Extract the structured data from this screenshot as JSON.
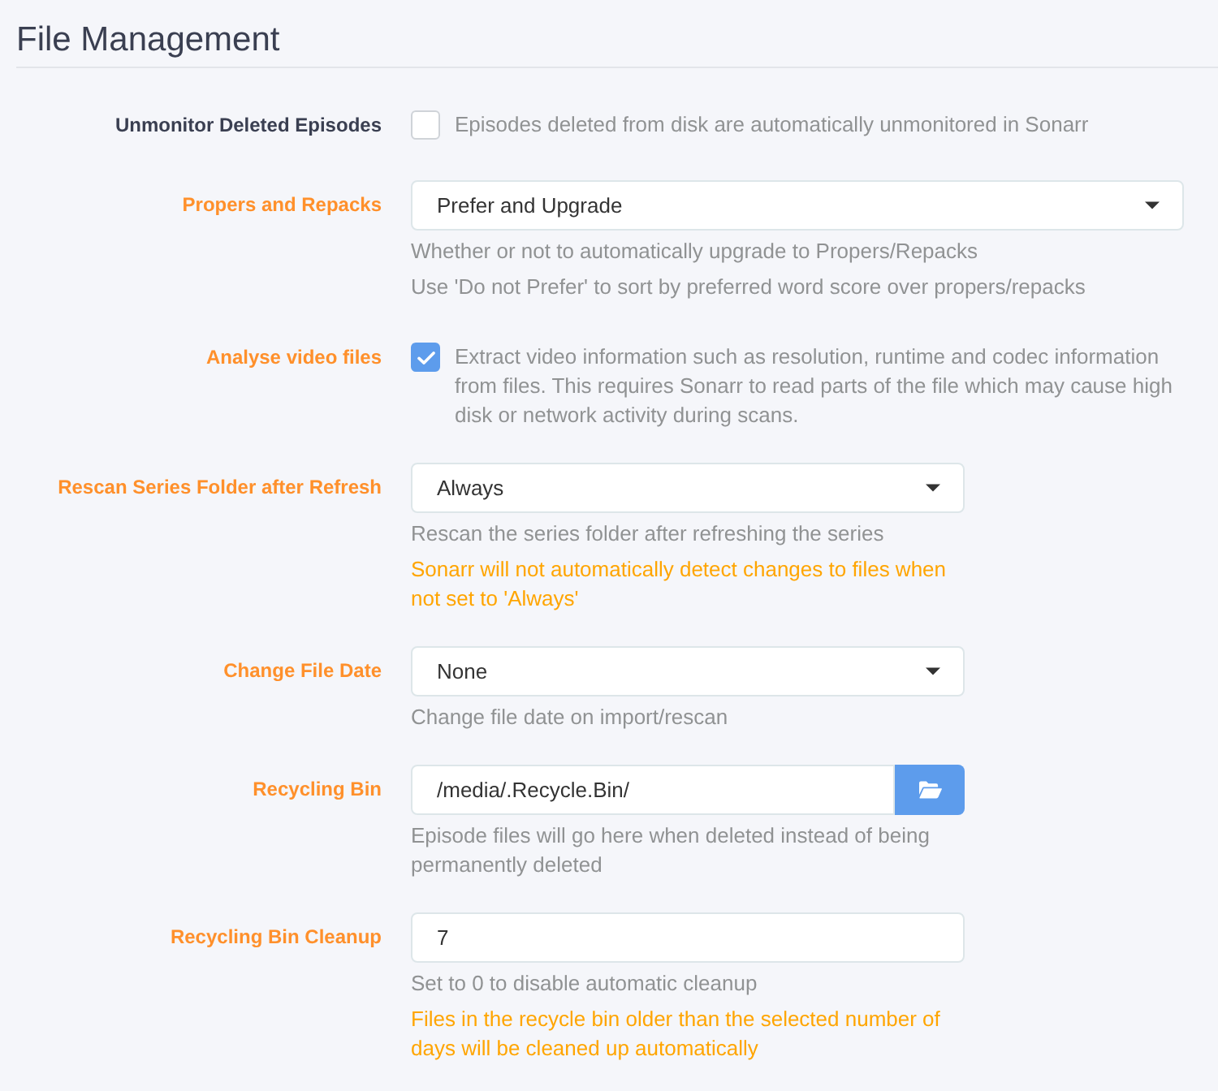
{
  "title": "File Management",
  "settings": [
    {
      "label": "Unmonitor Deleted Episodes",
      "advanced": false,
      "kind": "checkbox",
      "checked": false,
      "text": "Episodes deleted from disk are automatically unmonitored in Sonarr"
    },
    {
      "label": "Propers and Repacks",
      "advanced": true,
      "kind": "select",
      "value": "Prefer and Upgrade",
      "help": [
        {
          "kind": "info",
          "text": "Whether or not to automatically upgrade to Propers/Repacks"
        },
        {
          "kind": "info",
          "text": "Use 'Do not Prefer' to sort by preferred word score over propers/repacks"
        }
      ]
    },
    {
      "label": "Analyse video files",
      "advanced": true,
      "kind": "checkbox",
      "checked": true,
      "text": "Extract video information such as resolution, runtime and codec information from files. This requires Sonarr to read parts of the file which may cause high disk or network activity during scans."
    },
    {
      "label": "Rescan Series Folder after Refresh",
      "advanced": true,
      "kind": "select",
      "value": "Always",
      "help": [
        {
          "kind": "info",
          "text": "Rescan the series folder after refreshing the series"
        },
        {
          "kind": "warning",
          "text": "Sonarr will not automatically detect changes to files when not set to 'Always'"
        }
      ]
    },
    {
      "label": "Change File Date",
      "advanced": true,
      "kind": "select",
      "value": "None",
      "help": [
        {
          "kind": "info",
          "text": "Change file date on import/rescan"
        }
      ]
    },
    {
      "label": "Recycling Bin",
      "advanced": true,
      "kind": "path",
      "value": "/media/.Recycle.Bin/",
      "help": [
        {
          "kind": "info",
          "text": "Episode files will go here when deleted instead of being permanently deleted"
        }
      ]
    },
    {
      "label": "Recycling Bin Cleanup",
      "advanced": true,
      "kind": "number",
      "value": "7",
      "help": [
        {
          "kind": "info",
          "text": "Set to 0 to disable automatic cleanup"
        },
        {
          "kind": "warning",
          "text": "Files in the recycle bin older than the selected number of days will be cleaned up automatically"
        }
      ]
    }
  ]
}
